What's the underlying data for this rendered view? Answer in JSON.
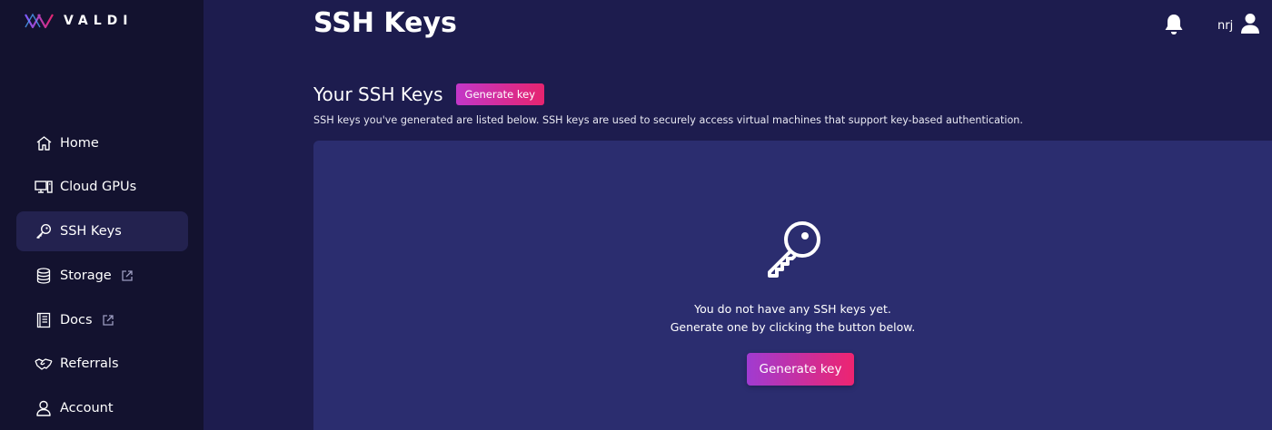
{
  "brand": {
    "name": "VALDI"
  },
  "sidebar": {
    "items": [
      {
        "label": "Home",
        "icon": "home-icon"
      },
      {
        "label": "Cloud GPUs",
        "icon": "computer-icon"
      },
      {
        "label": "SSH Keys",
        "icon": "key-icon",
        "active": true
      },
      {
        "label": "Storage",
        "icon": "database-icon",
        "external": true
      },
      {
        "label": "Docs",
        "icon": "book-icon",
        "external": true
      },
      {
        "label": "Referrals",
        "icon": "handshake-icon"
      },
      {
        "label": "Account",
        "icon": "user-icon"
      }
    ]
  },
  "header": {
    "title": "SSH Keys",
    "username": "nrj"
  },
  "section": {
    "title": "Your SSH Keys",
    "generate_label": "Generate key",
    "description": "SSH keys you've generated are listed below. SSH keys are used to securely access virtual machines that support key-based authentication."
  },
  "empty_state": {
    "line1": "You do not have any SSH keys yet.",
    "line2": "Generate one by clicking the button below.",
    "button_label": "Generate key"
  },
  "colors": {
    "background": "#1d1c4e",
    "sidebar": "#13122f",
    "panel": "#2b2d6f",
    "accent_start": "#c237c8",
    "accent_end": "#e6246f"
  }
}
